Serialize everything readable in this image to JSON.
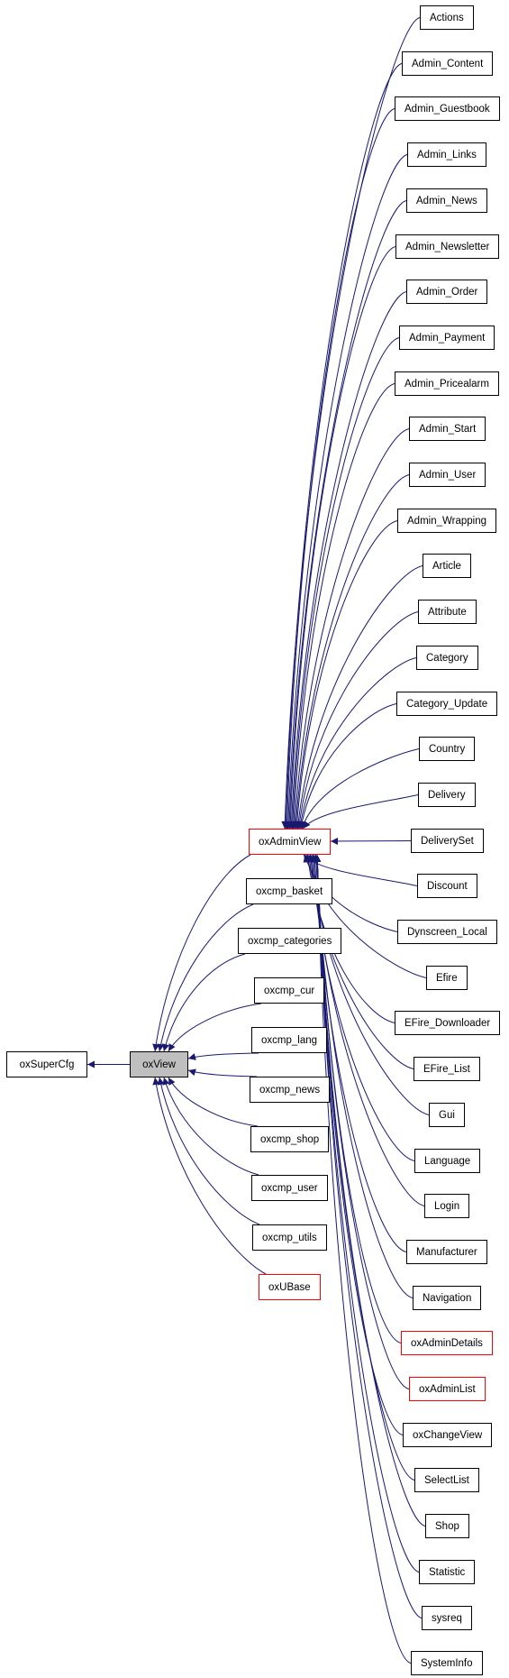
{
  "diagram": {
    "edge_color": "#191970",
    "truncated_border_color": "#ff0000",
    "current_fill": "#bfbfbf",
    "root": {
      "label": "oxSuperCfg"
    },
    "current": {
      "label": "oxView"
    },
    "view_children": [
      {
        "label": "oxAdminView",
        "truncated": true
      },
      {
        "label": "oxcmp_basket"
      },
      {
        "label": "oxcmp_categories"
      },
      {
        "label": "oxcmp_cur"
      },
      {
        "label": "oxcmp_lang"
      },
      {
        "label": "oxcmp_news"
      },
      {
        "label": "oxcmp_shop"
      },
      {
        "label": "oxcmp_user"
      },
      {
        "label": "oxcmp_utils"
      },
      {
        "label": "oxUBase",
        "truncated": true
      }
    ],
    "admin_view_children": [
      {
        "label": "Actions"
      },
      {
        "label": "Admin_Content"
      },
      {
        "label": "Admin_Guestbook"
      },
      {
        "label": "Admin_Links"
      },
      {
        "label": "Admin_News"
      },
      {
        "label": "Admin_Newsletter"
      },
      {
        "label": "Admin_Order"
      },
      {
        "label": "Admin_Payment"
      },
      {
        "label": "Admin_Pricealarm"
      },
      {
        "label": "Admin_Start"
      },
      {
        "label": "Admin_User"
      },
      {
        "label": "Admin_Wrapping"
      },
      {
        "label": "Article"
      },
      {
        "label": "Attribute"
      },
      {
        "label": "Category"
      },
      {
        "label": "Category_Update"
      },
      {
        "label": "Country"
      },
      {
        "label": "Delivery"
      },
      {
        "label": "DeliverySet"
      },
      {
        "label": "Discount"
      },
      {
        "label": "Dynscreen_Local"
      },
      {
        "label": "Efire"
      },
      {
        "label": "EFire_Downloader"
      },
      {
        "label": "EFire_List"
      },
      {
        "label": "Gui"
      },
      {
        "label": "Language"
      },
      {
        "label": "Login"
      },
      {
        "label": "Manufacturer"
      },
      {
        "label": "Navigation"
      },
      {
        "label": "oxAdminDetails",
        "truncated": true
      },
      {
        "label": "oxAdminList",
        "truncated": true
      },
      {
        "label": "oxChangeView"
      },
      {
        "label": "SelectList"
      },
      {
        "label": "Shop"
      },
      {
        "label": "Statistic"
      },
      {
        "label": "sysreq"
      },
      {
        "label": "SystemInfo"
      }
    ]
  }
}
